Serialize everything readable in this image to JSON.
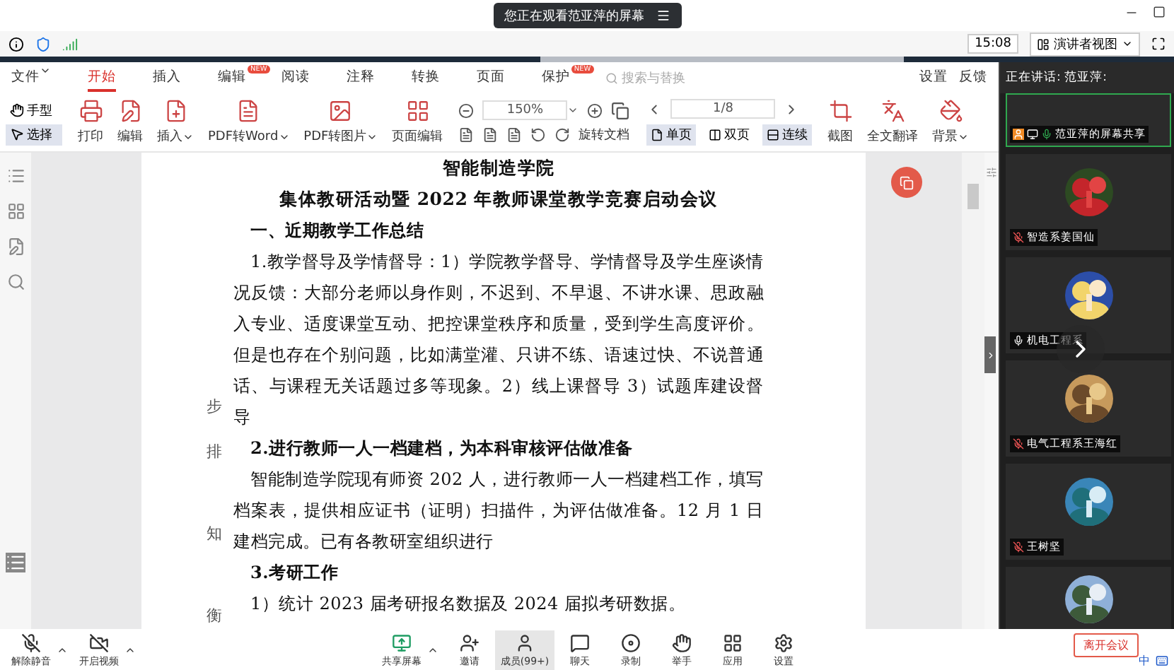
{
  "share_banner": {
    "text": "您正在观看范亚萍的屏幕"
  },
  "status": {
    "time": "15:08",
    "view_button": "演讲者视图"
  },
  "menu": {
    "items": [
      {
        "label": "文件",
        "dropdown": true,
        "selected": false
      },
      {
        "label": "开始",
        "dropdown": false,
        "selected": true
      },
      {
        "label": "插入",
        "dropdown": false,
        "selected": false
      },
      {
        "label": "编辑",
        "dropdown": false,
        "selected": false,
        "badge": "NEW"
      },
      {
        "label": "阅读",
        "dropdown": false,
        "selected": false
      },
      {
        "label": "注释",
        "dropdown": false,
        "selected": false
      },
      {
        "label": "转换",
        "dropdown": false,
        "selected": false
      },
      {
        "label": "页面",
        "dropdown": false,
        "selected": false
      },
      {
        "label": "保护",
        "dropdown": false,
        "selected": false,
        "badge": "NEW"
      }
    ],
    "search_placeholder": "搜索与替换",
    "right_items": [
      "设置",
      "反馈"
    ]
  },
  "toolbar": {
    "modes": [
      {
        "label": "手型",
        "selected": false
      },
      {
        "label": "选择",
        "selected": true
      }
    ],
    "actions": [
      {
        "label": "打印",
        "dropdown": false
      },
      {
        "label": "编辑",
        "dropdown": false
      },
      {
        "label": "插入",
        "dropdown": true
      },
      {
        "label": "PDF转Word",
        "dropdown": true
      },
      {
        "label": "PDF转图片",
        "dropdown": true
      },
      {
        "label": "页面编辑",
        "dropdown": false
      }
    ],
    "zoom": "150%",
    "rotate_label": "旋转文档",
    "page": "1/8",
    "views": [
      {
        "label": "单页",
        "selected": true
      },
      {
        "label": "双页",
        "selected": false
      },
      {
        "label": "连续",
        "selected": true
      }
    ],
    "tools": [
      {
        "label": "截图",
        "dropdown": false
      },
      {
        "label": "全文翻译",
        "dropdown": false
      },
      {
        "label": "背景",
        "dropdown": true
      }
    ]
  },
  "document": {
    "paragraphs": [
      {
        "kind": "title",
        "text": "智能制造学院"
      },
      {
        "kind": "title",
        "text": "集体教研活动暨 2022 年教师课堂教学竞赛启动会议"
      },
      {
        "kind": "heading",
        "text": "一、近期教学工作总结"
      },
      {
        "kind": "body",
        "text": "1.教学督导及学情督导：1）学院教学督导、学情督导及学生座谈情况反馈：大部分老师以身作则，不迟到、不早退、不讲水课、思政融入专业、适度课堂互动、把控课堂秩序和质量，受到学生高度评价。但是也存在个别问题，比如满堂灌、只讲不练、语速过快、不说普通话、与课程无关话题过多等现象。2）线上课督导 3）试题库建设督导"
      },
      {
        "kind": "heading",
        "text": "2.进行教师一人一档建档，为本科审核评估做准备"
      },
      {
        "kind": "body",
        "text": "智能制造学院现有师资 202 人，进行教师一人一档建档工作，填写档案表，提供相应证书（证明）扫描件，为评估做准备。12 月 1 日建档完成。已有各教研室组织进行"
      },
      {
        "kind": "heading",
        "text": "3.考研工作"
      },
      {
        "kind": "body",
        "text": "1）统计 2023 届考研报名数据及 2024 届拟考研数据。"
      }
    ],
    "margin_notes": [
      "步",
      "排",
      "知",
      "衡"
    ]
  },
  "participants": {
    "speaking": "正在讲话: 范亚萍:",
    "tiles": [
      {
        "kind": "participant",
        "name": "范亚萍的屏幕共享",
        "muted": false,
        "sharing": true
      },
      {
        "kind": "participant",
        "name": "智造系姜国仙",
        "muted": true,
        "sharing": false
      },
      {
        "kind": "participant",
        "name": "机电工程系",
        "muted": false,
        "sharing": false
      },
      {
        "kind": "participant",
        "name": "电气工程系王海红",
        "muted": true,
        "sharing": false
      },
      {
        "kind": "participant",
        "name": "王树坚",
        "muted": true,
        "sharing": false
      },
      {
        "kind": "partial"
      }
    ]
  },
  "bottom": {
    "left": [
      {
        "kind": "mic",
        "label": "解除静音"
      },
      {
        "kind": "video",
        "label": "开启视频"
      }
    ],
    "center": [
      {
        "kind": "share",
        "label": "共享屏幕",
        "selected": false
      },
      {
        "kind": "invite",
        "label": "邀请",
        "selected": false
      },
      {
        "kind": "members",
        "label": "成员(99+)",
        "selected": true
      },
      {
        "kind": "chat",
        "label": "聊天",
        "selected": false
      },
      {
        "kind": "record",
        "label": "录制",
        "selected": false
      },
      {
        "kind": "hand",
        "label": "举手",
        "selected": false
      },
      {
        "kind": "apps",
        "label": "应用",
        "selected": false
      },
      {
        "kind": "settings",
        "label": "设置",
        "selected": false
      }
    ],
    "leave": "离开会议",
    "ime": "中"
  }
}
